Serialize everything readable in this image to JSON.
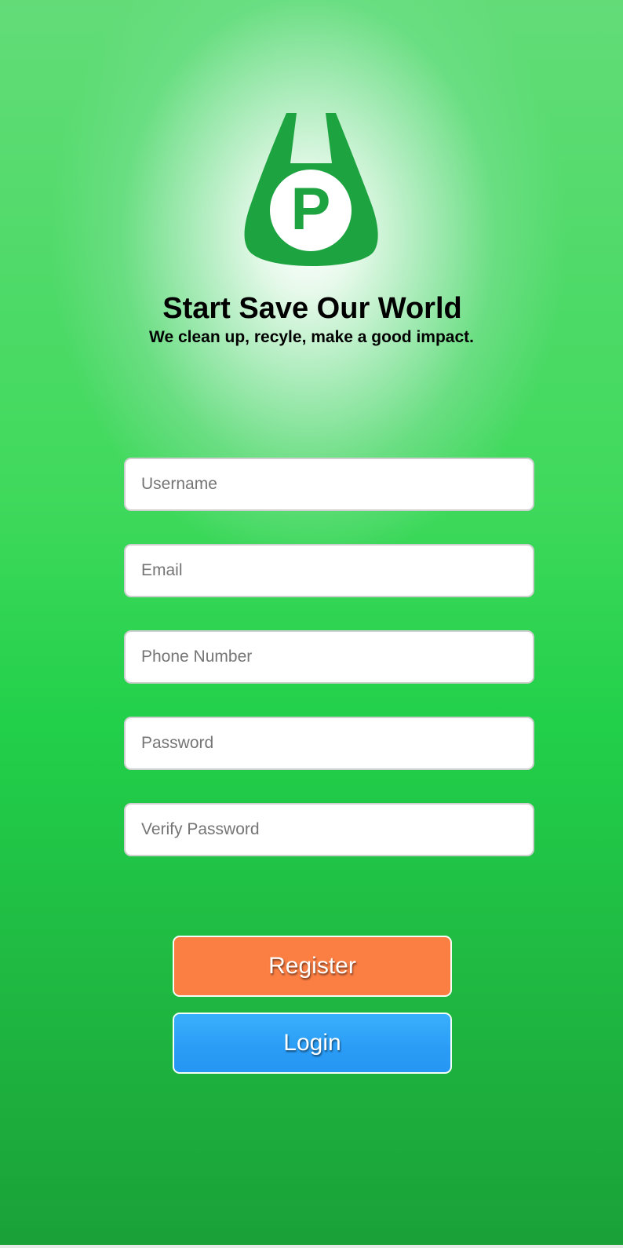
{
  "brand": {
    "logo_letter": "P",
    "logo_color": "#1da33f"
  },
  "header": {
    "title": "Start Save Our World",
    "subtitle": "We clean up, recyle, make a good impact."
  },
  "form": {
    "username_placeholder": "Username",
    "email_placeholder": "Email",
    "phone_placeholder": "Phone Number",
    "password_placeholder": "Password",
    "verify_password_placeholder": "Verify Password"
  },
  "actions": {
    "register_label": "Register",
    "login_label": "Login",
    "register_color": "#fb7e43",
    "login_color": "#2a9cf6"
  },
  "theme": {
    "background_top": "#63dc78",
    "background_bottom": "#1aa138"
  }
}
